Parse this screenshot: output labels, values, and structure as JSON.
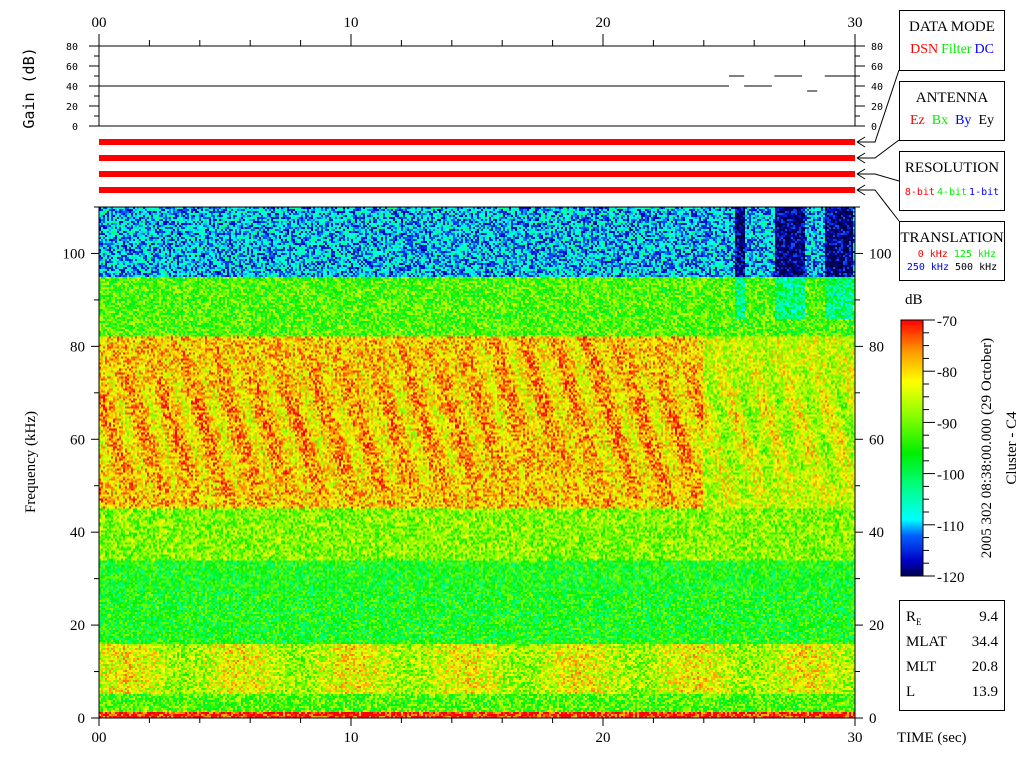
{
  "chart_data": {
    "type": "heatmap",
    "title": "",
    "xlabel": "TIME (sec)",
    "ylabel": "Frequency (kHz)",
    "xlim": [
      0,
      30
    ],
    "ylim": [
      0,
      110
    ],
    "x_ticks": [
      "00",
      "10",
      "20",
      "30"
    ],
    "x_tick_values": [
      0,
      10,
      20,
      30
    ],
    "y_ticks": [
      "0",
      "20",
      "40",
      "60",
      "80",
      "100"
    ],
    "y_tick_values": [
      0,
      20,
      40,
      60,
      80,
      100
    ],
    "colorbar": {
      "label": "dB",
      "range": [
        -120,
        -70
      ],
      "ticks": [
        "-70",
        "-80",
        "-90",
        "-100",
        "-110",
        "-120"
      ],
      "tick_values": [
        -70,
        -80,
        -90,
        -100,
        -110,
        -120
      ]
    },
    "frequency_profile_db": [
      {
        "f": [
          0,
          1.5
        ],
        "db": -71
      },
      {
        "f": [
          1.5,
          5
        ],
        "db": -92
      },
      {
        "f": [
          5,
          16
        ],
        "db": -85
      },
      {
        "f": [
          16,
          34
        ],
        "db": -96
      },
      {
        "f": [
          34,
          45
        ],
        "db": -89
      },
      {
        "f": [
          45,
          82
        ],
        "db": -79
      },
      {
        "f": [
          82,
          95
        ],
        "db": -92
      },
      {
        "f": [
          95,
          110
        ],
        "db": -110
      }
    ],
    "gain_panel": {
      "ylabel": "Gain (dB)",
      "ylim": [
        0,
        80
      ],
      "y_ticks": [
        "0",
        "20",
        "40",
        "60",
        "80"
      ],
      "y_tick_values": [
        0,
        20,
        40,
        60,
        80
      ],
      "series": [
        {
          "t": [
            0,
            25.0
          ],
          "gain": 40
        },
        {
          "t": [
            25.0,
            25.6
          ],
          "gain": 50
        },
        {
          "t": [
            25.6,
            26.7
          ],
          "gain": 40
        },
        {
          "t": [
            26.8,
            27.9
          ],
          "gain": 50
        },
        {
          "t": [
            28.1,
            28.5
          ],
          "gain": 35
        },
        {
          "t": [
            28.8,
            30
          ],
          "gain": 50
        }
      ]
    },
    "status_bars": {
      "count": 4,
      "color": "#ff0000",
      "t": [
        0,
        30
      ]
    }
  },
  "legend": {
    "data_mode": {
      "title": "DATA MODE",
      "items": [
        {
          "label": "DSN",
          "color": "#ff0000"
        },
        {
          "label": "Filter",
          "color": "#00e000"
        },
        {
          "label": "DC",
          "color": "#0000ff"
        }
      ]
    },
    "antenna": {
      "title": "ANTENNA",
      "items": [
        {
          "label": "Ez",
          "color": "#ff0000"
        },
        {
          "label": "Bx",
          "color": "#00e000"
        },
        {
          "label": "By",
          "color": "#0000ff"
        },
        {
          "label": "Ey",
          "color": "#000000"
        }
      ]
    },
    "resolution": {
      "title": "RESOLUTION",
      "items": [
        {
          "label": "8-bit",
          "color": "#ff0000"
        },
        {
          "label": "4-bit",
          "color": "#00e000"
        },
        {
          "label": "1-bit",
          "color": "#0000ff"
        }
      ]
    },
    "translation": {
      "title": "TRANSLATION",
      "items": [
        {
          "label": "0 kHz",
          "color": "#ff0000"
        },
        {
          "label": "125 kHz",
          "color": "#00e000"
        },
        {
          "label": "250 kHz",
          "color": "#0000ff"
        },
        {
          "label": "500 kHz",
          "color": "#000000"
        }
      ]
    }
  },
  "side_caption": "2005 302 08:38:00.000 (29 October)",
  "side_caption2": "Cluster - C4",
  "info": [
    {
      "label": "R",
      "sub": "E",
      "value": "9.4"
    },
    {
      "label": "MLAT",
      "value": "34.4"
    },
    {
      "label": "MLT",
      "value": "20.8"
    },
    {
      "label": "L",
      "value": "13.9"
    }
  ]
}
